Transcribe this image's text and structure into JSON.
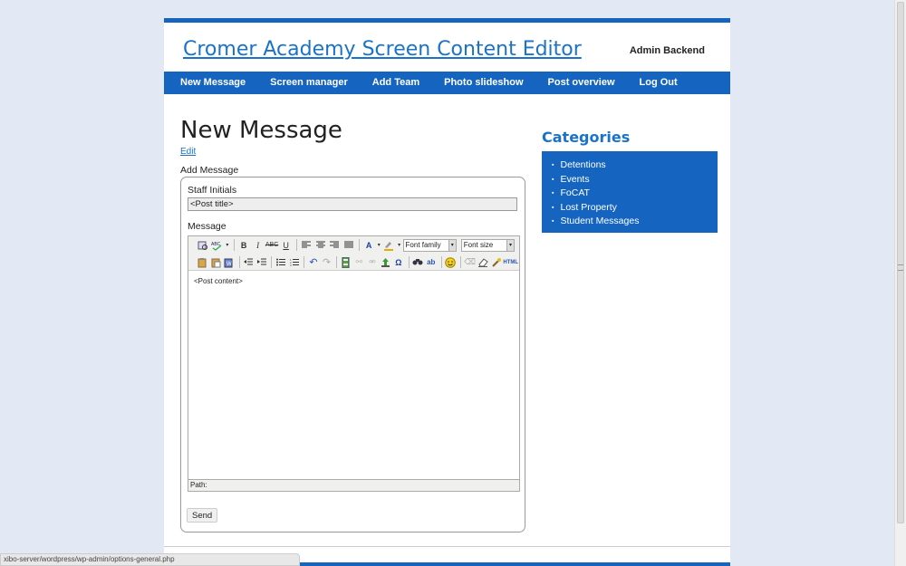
{
  "header": {
    "site_title": "Cromer Academy Screen Content Editor",
    "admin_link": "Admin Backend"
  },
  "nav": {
    "items": [
      "New Message",
      "Screen manager",
      "Add Team",
      "Photo slideshow",
      "Post overview",
      "Log Out"
    ]
  },
  "main": {
    "title": "New Message",
    "edit_link": "Edit",
    "form_label": "Add Message",
    "staff_initials_label": "Staff Initials",
    "post_title_value": "<Post title>",
    "message_label": "Message",
    "font_family_select": "Font family",
    "font_size_select": "Font size",
    "post_content": "<Post content>",
    "path_label": "Path:",
    "send_button": "Send"
  },
  "sidebar": {
    "categories_title": "Categories",
    "categories": [
      "Detentions",
      "Events",
      "FoCAT",
      "Lost Property",
      "Student Messages"
    ]
  },
  "status_bar": {
    "url": "xibo-server/wordpress/wp-admin/options-general.php"
  },
  "colors": {
    "accent": "#1565c0",
    "link": "#1a73c8",
    "background": "#e3e8f5"
  }
}
